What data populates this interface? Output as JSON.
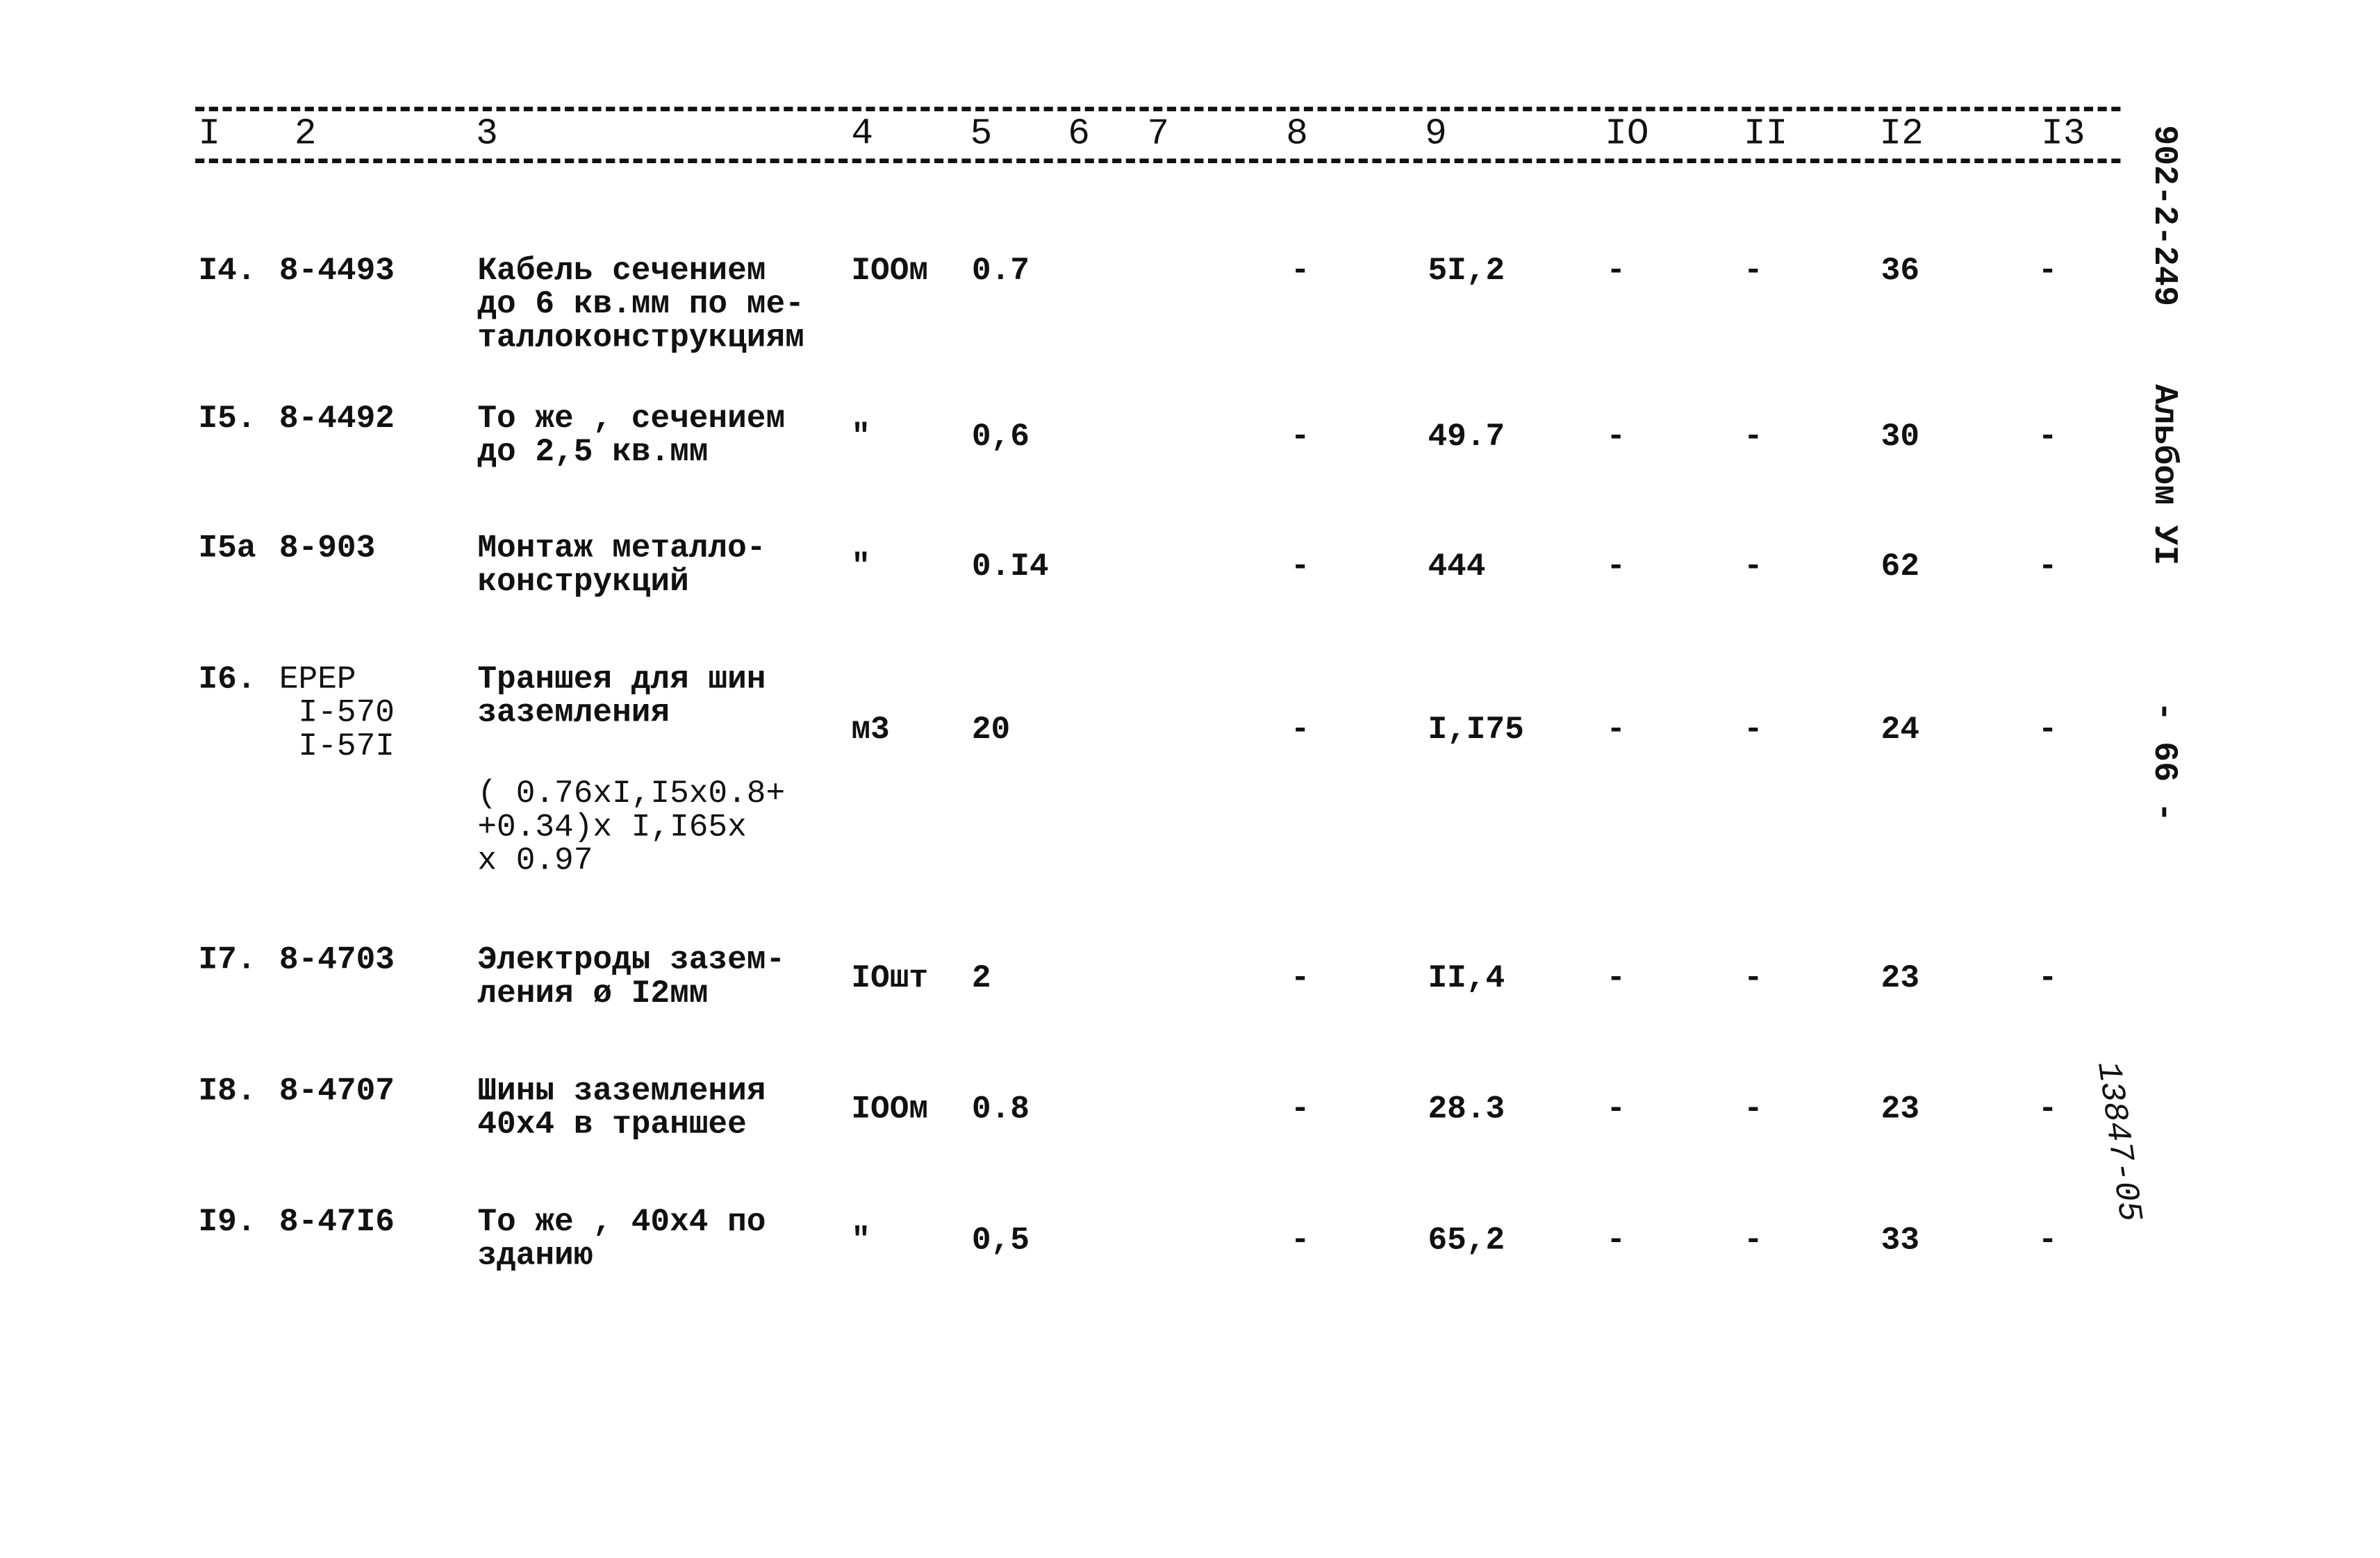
{
  "header": {
    "columns": [
      "I",
      "2",
      "3",
      "4",
      "5",
      "6",
      "7",
      "8",
      "9",
      "IO",
      "II",
      "I2",
      "I3"
    ]
  },
  "rows": [
    {
      "num": "I4.",
      "code": "8-4493",
      "desc": "Кабель сечением\nдо 6 кв.мм по ме-\nталлоконструкциям",
      "unit": "IOOм",
      "qty": "0.7",
      "c8": "-",
      "c9": "5I,2",
      "c10": "-",
      "c11": "-",
      "c12": "36",
      "c13": "-"
    },
    {
      "num": "I5.",
      "code": "8-4492",
      "desc": "То же , сечением\nдо 2,5 кв.мм",
      "unit": "\"",
      "qty": "0,6",
      "c8": "-",
      "c9": "49.7",
      "c10": "-",
      "c11": "-",
      "c12": "30",
      "c13": "-"
    },
    {
      "num": "I5а",
      "code": "8-903",
      "desc": "Монтаж металло-\nконструкций",
      "unit": "\"",
      "qty": "0.I4",
      "c8": "-",
      "c9": "444",
      "c10": "-",
      "c11": "-",
      "c12": "62",
      "c13": "-"
    },
    {
      "num": "I6.",
      "code": "ЕРЕР\n I-570\n I-57I",
      "desc": "Траншея для шин\nзаземления",
      "formula": "( 0.76xI,I5x0.8+\n+0.34)x I,I65x\nx 0.97",
      "unit": "м3",
      "qty": "20",
      "c8": "-",
      "c9": "I,I75",
      "c10": "-",
      "c11": "-",
      "c12": "24",
      "c13": "-"
    },
    {
      "num": "I7.",
      "code": "8-4703",
      "desc": "Электроды зазем-\nления ø I2мм",
      "unit": "IOшт",
      "qty": "2",
      "c8": "-",
      "c9": "II,4",
      "c10": "-",
      "c11": "-",
      "c12": "23",
      "c13": "-"
    },
    {
      "num": "I8.",
      "code": "8-4707",
      "desc": "Шины заземления\n40x4 в траншее",
      "unit": "IOOм",
      "qty": "0.8",
      "c8": "-",
      "c9": "28.3",
      "c10": "-",
      "c11": "-",
      "c12": "23",
      "c13": "-"
    },
    {
      "num": "I9.",
      "code": "8-47I6",
      "desc": "То же , 40x4 по\nзданию",
      "unit": "\"",
      "qty": "0,5",
      "c8": "-",
      "c9": "65,2",
      "c10": "-",
      "c11": "-",
      "c12": "33",
      "c13": "-"
    }
  ],
  "side": {
    "doc_code": "902-2-249",
    "album": "Альбом УI",
    "page": "- 66 -",
    "stamp": "13847-05"
  }
}
